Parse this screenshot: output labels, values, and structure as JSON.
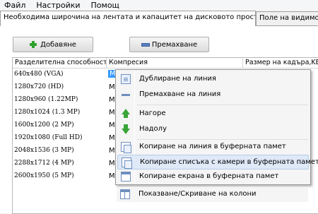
{
  "menu": [
    "Файл",
    "Настройки",
    "Помощ"
  ],
  "tabs": {
    "active": "Необходима широчина на лентата и капацитет на дисковото пространство",
    "other": "Поле на видимост"
  },
  "toolbar": {
    "add_label": "Добавяне",
    "remove_label": "Премахване"
  },
  "table": {
    "headers": [
      "Разделителна способност",
      "Компресия",
      "Размер на кадъра,KB"
    ],
    "rows": [
      {
        "res": "640x480 (VGA)",
        "comp": "M"
      },
      {
        "res": "1280x720 (HD)",
        "comp": "M"
      },
      {
        "res": "1280x960 (1.22MP)",
        "comp": "M"
      },
      {
        "res": "1280x1024 (1.3 MP)",
        "comp": "M"
      },
      {
        "res": "1600x1200 (2 MP)",
        "comp": "M"
      },
      {
        "res": "1920x1080 (Full HD)",
        "comp": "M"
      },
      {
        "res": "2048x1536 (3 MP)",
        "comp": "M"
      },
      {
        "res": "2288x1712 (4 MP)",
        "comp": "M"
      },
      {
        "res": "2600x1950 (5 MP)",
        "comp": "M"
      }
    ]
  },
  "context_menu": {
    "items": [
      {
        "label": "Дублиране на линия",
        "icon": "duplicate-icon"
      },
      {
        "label": "Премахване на линия",
        "icon": "remove-line-icon"
      },
      {
        "label": "Нагоре",
        "icon": "arrow-up-icon"
      },
      {
        "label": "Надолу",
        "icon": "arrow-down-icon"
      },
      {
        "label": "Копиране на линия в буферната памет",
        "icon": "copy-line-icon"
      },
      {
        "label": "Копиране списъка с камери в буферната памет",
        "icon": "copy-list-icon"
      },
      {
        "label": "Копиране екрана в буферната памет",
        "icon": "copy-screen-icon"
      },
      {
        "label": "Показване/Скриване на колони",
        "icon": "columns-icon"
      }
    ],
    "highlighted_index": 5
  }
}
